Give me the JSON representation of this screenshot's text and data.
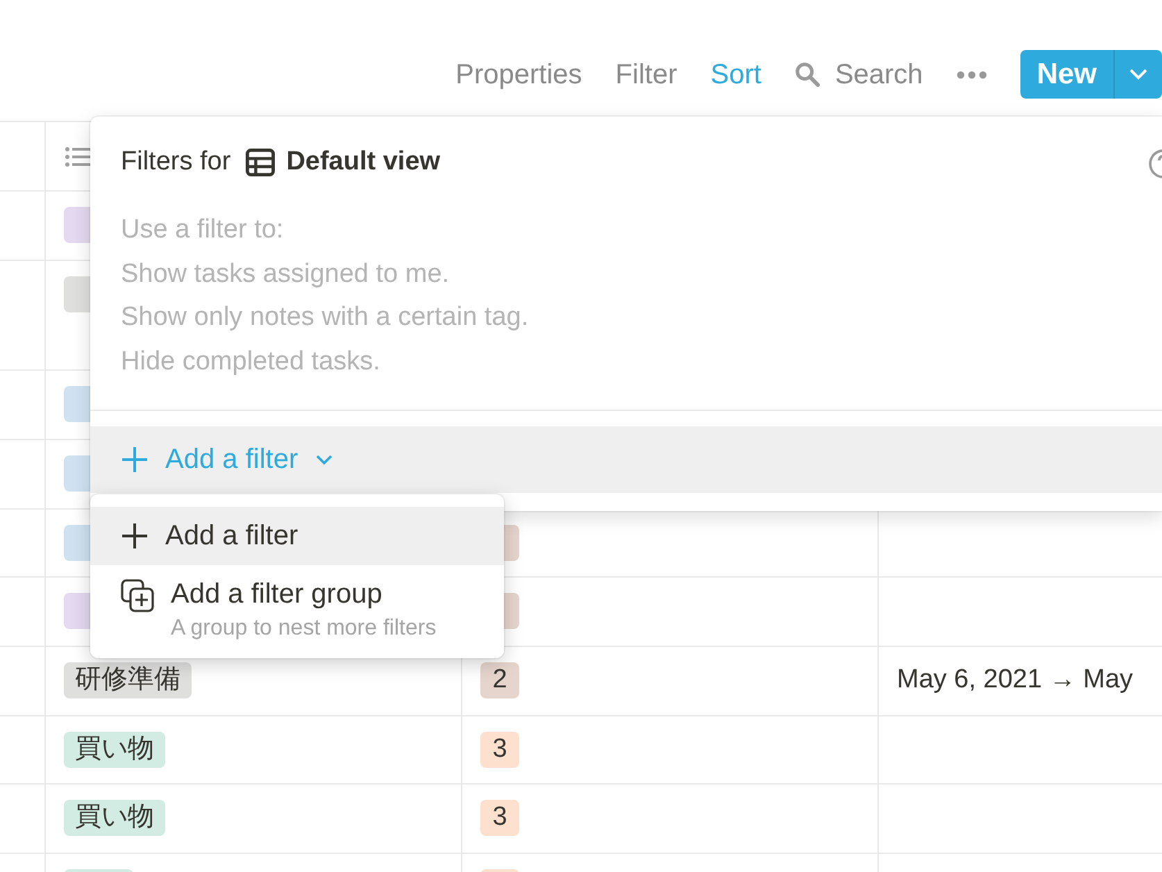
{
  "toolbar": {
    "items": [
      {
        "kind": "text",
        "label": "Properties",
        "active": false
      },
      {
        "kind": "text",
        "label": "Filter",
        "active": false
      },
      {
        "kind": "text",
        "label": "Sort",
        "active": true
      },
      {
        "kind": "search",
        "label": "Search",
        "active": false
      },
      {
        "kind": "more",
        "active": false
      }
    ],
    "new_button": "New"
  },
  "table": {
    "rows": [
      {
        "tag": {
          "color": "#e4d9f0"
        }
      },
      {
        "tag": {
          "color": "#dfdfde"
        }
      },
      {
        "tag": {
          "color": "#d0e2f1"
        }
      },
      {
        "tag": {
          "color": "#d0e2f1"
        }
      },
      {
        "tag": {
          "color": "#d0e2f1"
        },
        "number": {
          "color": "#e6d5cd"
        }
      },
      {
        "tag": {
          "color": "#e4d9f0"
        },
        "number": {
          "color": "#e6d5cd"
        }
      },
      {
        "tag": {
          "text": "研修準備",
          "color": "#dfdfde"
        },
        "number": {
          "text": "2",
          "color": "#e6d5cd"
        },
        "date": "May 6, 2021 → May"
      },
      {
        "tag": {
          "text": "買い物",
          "color": "#d2ebe3"
        },
        "number": {
          "text": "3",
          "color": "#fde0cd"
        }
      },
      {
        "tag": {
          "text": "買い物",
          "color": "#d2ebe3"
        },
        "number": {
          "text": "3",
          "color": "#fde0cd"
        }
      },
      {
        "tag": {
          "color": "#d2ebe3"
        },
        "number": {
          "color": "#fde0cd"
        }
      }
    ]
  },
  "filter_popup": {
    "title": "Filters for",
    "view_name": "Default view",
    "hints": [
      "Use a filter to:",
      "Show tasks assigned to me.",
      "Show only notes with a certain tag.",
      "Hide completed tasks."
    ],
    "add_filter": "Add a filter"
  },
  "menu": {
    "items": [
      {
        "kind": "filter",
        "label": "Add a filter",
        "selected": true
      },
      {
        "kind": "group",
        "label": "Add a filter group",
        "description": "A group to nest more filters",
        "selected": false
      }
    ]
  }
}
